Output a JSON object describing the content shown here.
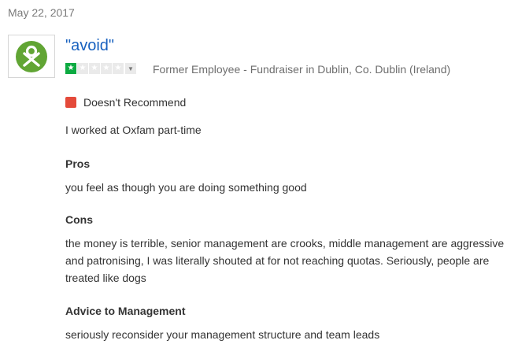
{
  "date": "May 22, 2017",
  "review": {
    "title": "\"avoid\"",
    "rating": 1,
    "rating_max": 5,
    "author": "Former Employee - Fundraiser in Dublin, Co. Dublin (Ireland)",
    "recommendation": "Doesn't Recommend",
    "summary": "I worked at Oxfam part-time",
    "pros_heading": "Pros",
    "pros": "you feel as though you are doing something good",
    "cons_heading": "Cons",
    "cons": "the money is terrible, senior management are crooks, middle management are aggressive and patronising, I was literally shouted at for not reaching quotas. Seriously, people are treated like dogs",
    "advice_heading": "Advice to Management",
    "advice": "seriously reconsider your management structure and team leads"
  },
  "colors": {
    "title": "#1861bf",
    "star_on": "#0caa41",
    "not_recommend": "#e44a3a",
    "logo_green": "#61a534"
  },
  "icons": {
    "logo": "oxfam-logo-icon",
    "star": "star-icon",
    "dropdown": "chevron-down-icon",
    "recommend": "red-square-icon"
  }
}
